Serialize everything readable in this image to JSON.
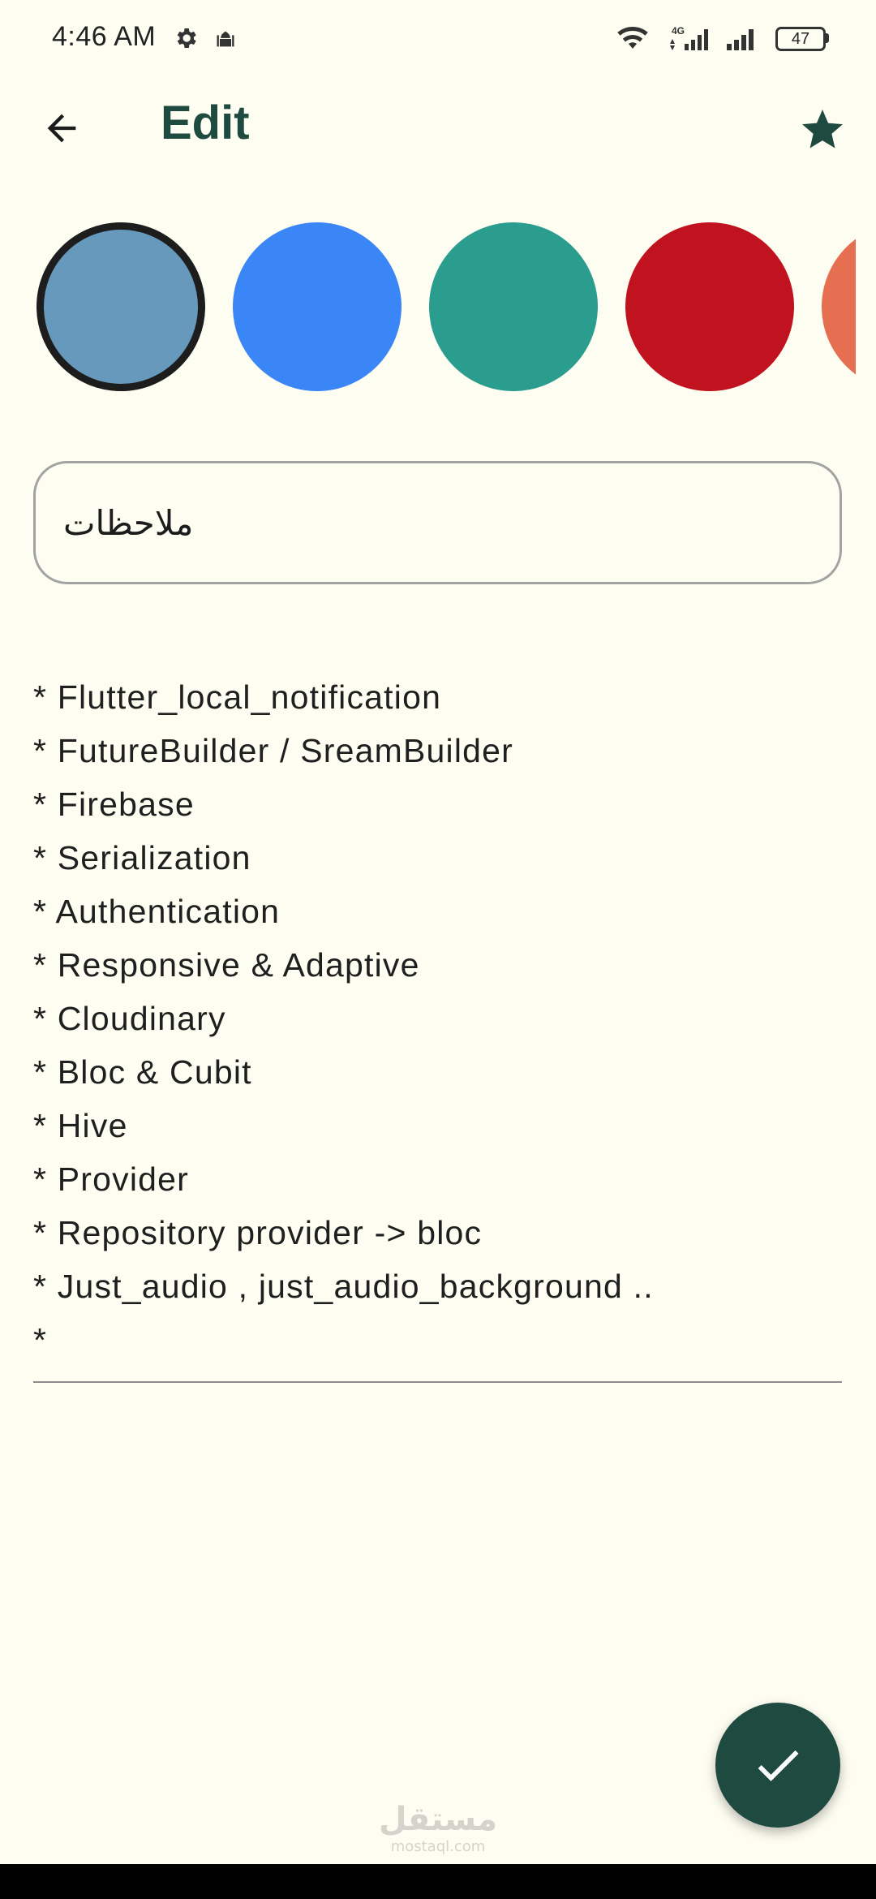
{
  "status_bar": {
    "time": "4:46 AM",
    "battery": "47",
    "icons": [
      "gear-icon",
      "mosque-icon",
      "wifi-icon",
      "signal-4g-icon",
      "signal-icon",
      "battery-icon"
    ]
  },
  "app_bar": {
    "title": "Edit",
    "back_icon": "arrow-left-icon",
    "favorite_icon": "star-icon"
  },
  "palette": {
    "colors": [
      "#6699bb",
      "#3b86f7",
      "#2a9d8f",
      "#c1121f",
      "#e76f51"
    ],
    "selected_index": 0
  },
  "title_field": {
    "value": "ملاحظات"
  },
  "body": {
    "lines": [
      "* Flutter_local_notification",
      "* FutureBuilder / SreamBuilder",
      "* Firebase",
      "* Serialization",
      "* Authentication",
      "* Responsive & Adaptive",
      "* Cloudinary",
      "* Bloc & Cubit",
      "* Hive",
      "* Provider",
      "* Repository provider -> bloc",
      "* Just_audio , just_audio_background ..",
      "*"
    ]
  },
  "fab": {
    "icon": "check-icon"
  },
  "watermark": {
    "arabic": "مستقل",
    "latin": "mostaql.com"
  }
}
